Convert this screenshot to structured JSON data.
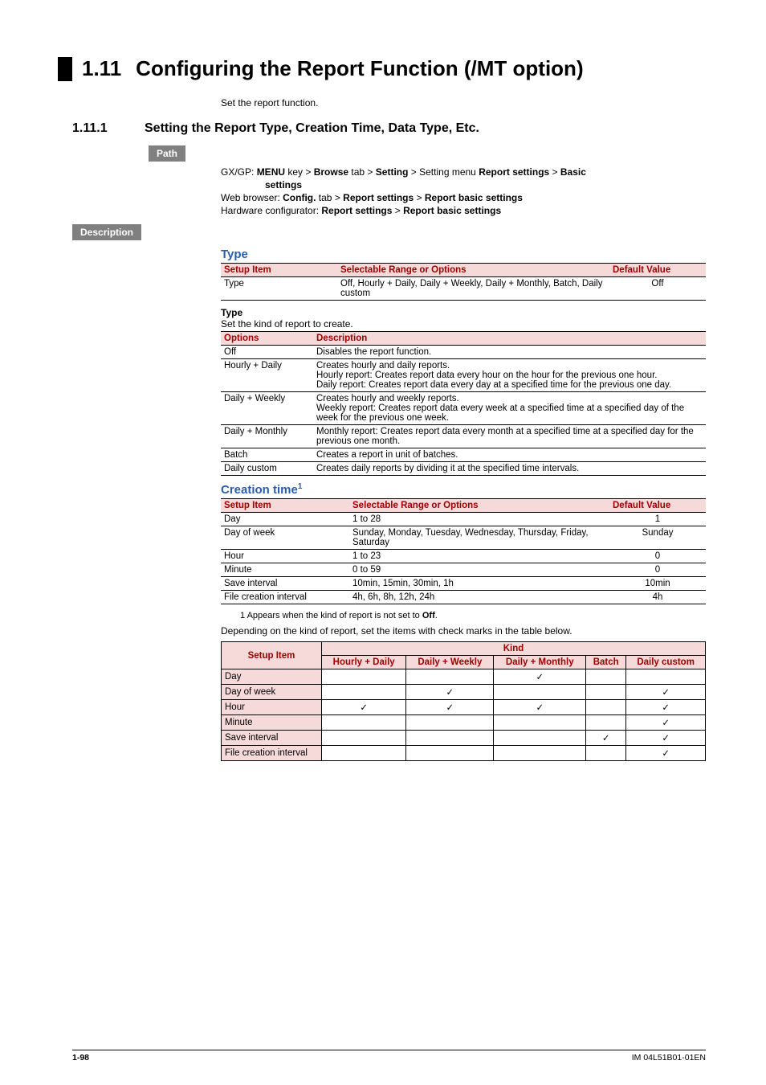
{
  "h1": {
    "num": "1.11",
    "text": "Configuring the Report Function (/MT option)"
  },
  "intro": "Set the report function.",
  "h2": {
    "num": "1.11.1",
    "text": "Setting the Report Type, Creation Time, Data Type, Etc."
  },
  "pill_path": "Path",
  "pill_desc": "Description",
  "path": {
    "l1a": "GX/GP: ",
    "l1b": "MENU",
    "l1c": " key > ",
    "l1d": "Browse",
    "l1e": " tab > ",
    "l1f": "Setting",
    "l1g": " > Setting menu ",
    "l1h": "Report settings",
    "l1i": " > ",
    "l1j": "Basic",
    "l1k": "settings",
    "l2a": "Web browser: ",
    "l2b": "Config.",
    "l2c": " tab > ",
    "l2d": "Report settings",
    "l2e": " > ",
    "l2f": "Report basic settings",
    "l3a": "Hardware configurator: ",
    "l3b": "Report settings",
    "l3c": " > ",
    "l3d": "Report basic settings"
  },
  "type_section_title": "Type",
  "tbl_headers": {
    "setup": "Setup Item",
    "range": "Selectable Range or Options",
    "def": "Default Value",
    "options": "Options",
    "desc": "Description"
  },
  "type_table": {
    "row1": {
      "item": "Type",
      "range": "Off, Hourly + Daily, Daily + Weekly, Daily + Monthly, Batch, Daily custom",
      "def": "Off"
    }
  },
  "type_sub_heading": "Type",
  "type_sub_desc": "Set the kind of report to create.",
  "type_options": [
    {
      "opt": "Off",
      "desc": "Disables the report function."
    },
    {
      "opt": "Hourly + Daily",
      "desc": "Creates hourly and daily reports.\nHourly report: Creates report data every hour on the hour for the previous one hour.\nDaily report: Creates report data every day at a specified time for the previous one day."
    },
    {
      "opt": "Daily + Weekly",
      "desc": "Creates hourly and weekly reports.\nWeekly report: Creates report data every week at a specified time at a specified day of the week for the previous one week."
    },
    {
      "opt": "Daily + Monthly",
      "desc": "Monthly report: Creates report data every month at a specified time at a specified day for the previous one month."
    },
    {
      "opt": "Batch",
      "desc": "Creates a report in unit of batches."
    },
    {
      "opt": "Daily custom",
      "desc": "Creates daily reports by dividing it at the specified time intervals."
    }
  ],
  "creation_title": "Creation time",
  "creation_sup": "1",
  "creation_table": [
    {
      "item": "Day",
      "range": "1 to 28",
      "def": "1"
    },
    {
      "item": "Day of week",
      "range": "Sunday, Monday, Tuesday, Wednesday, Thursday, Friday, Saturday",
      "def": "Sunday"
    },
    {
      "item": "Hour",
      "range": "1 to 23",
      "def": "0"
    },
    {
      "item": "Minute",
      "range": "0 to 59",
      "def": "0"
    },
    {
      "item": "Save interval",
      "range": "10min, 15min, 30min, 1h",
      "def": "10min"
    },
    {
      "item": "File creation interval",
      "range": "4h, 6h, 8h, 12h, 24h",
      "def": "4h"
    }
  ],
  "footnote1_prefix": "1   Appears when the kind of report is not set to ",
  "footnote1_bold": "Off",
  "footnote1_suffix": ".",
  "depends_text": "Depending on the kind of report, set the items with check marks in the table below.",
  "matrix": {
    "kind": "Kind",
    "cols": [
      "Hourly + Daily",
      "Daily + Weekly",
      "Daily + Monthly",
      "Batch",
      "Daily custom"
    ],
    "rows": [
      {
        "label": "Day",
        "v": [
          "",
          "",
          "✓",
          "",
          ""
        ]
      },
      {
        "label": "Day of week",
        "v": [
          "",
          "✓",
          "",
          "",
          "✓"
        ]
      },
      {
        "label": "Hour",
        "v": [
          "✓",
          "✓",
          "✓",
          "",
          "✓"
        ]
      },
      {
        "label": "Minute",
        "v": [
          "",
          "",
          "",
          "",
          "✓"
        ]
      },
      {
        "label": "Save interval",
        "v": [
          "",
          "",
          "",
          "✓",
          "✓"
        ]
      },
      {
        "label": "File creation interval",
        "v": [
          "",
          "",
          "",
          "",
          "✓"
        ]
      }
    ]
  },
  "footer": {
    "page": "1-98",
    "doc": "IM 04L51B01-01EN"
  }
}
